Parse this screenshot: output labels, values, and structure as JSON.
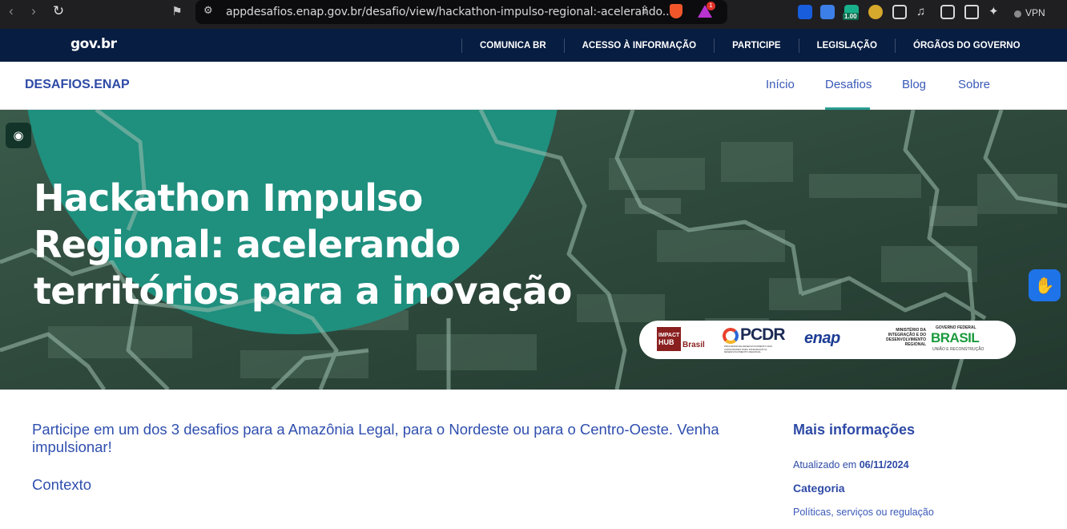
{
  "browser": {
    "url": "appdesafios.enap.gov.br/desafio/view/hackathon-impulso-regional:-acelerando...",
    "vpn_label": "VPN",
    "ext_badge": "1.00",
    "brave_badge": "1"
  },
  "govbar": {
    "logo": "gov.br",
    "links": [
      "COMUNICA BR",
      "ACESSO À INFORMAÇÃO",
      "PARTICIPE",
      "LEGISLAÇÃO",
      "ÓRGÃOS DO GOVERNO"
    ]
  },
  "site": {
    "brand": "DESAFIOS.ENAP",
    "nav": [
      "Início",
      "Desafios",
      "Blog",
      "Sobre"
    ],
    "active_nav": "Desafios"
  },
  "hero": {
    "title": "Hackathon Impulso Regional: acelerando territórios para a inovação",
    "partners": {
      "impact_hub_line1": "IMPACT",
      "impact_hub_line2": "HUB",
      "impact_hub_brasil": "Brasil",
      "pcdr": "PCDR",
      "pcdr_sub": "PROGRAMA DE DESENVOLVIMENTO DAS CAPACIDADES PARA INTEGRAÇÃO E DESENVOLVIMENTO REGIONAL",
      "enap": "enap",
      "ministerio": "MINISTÉRIO DA INTEGRAÇÃO E DO DESENVOLVIMENTO REGIONAL",
      "governo_federal": "GOVERNO FEDERAL",
      "brasil": "BRASIL",
      "uniao": "UNIÃO E RECONSTRUÇÃO"
    }
  },
  "content": {
    "lead": "Participe em um dos 3 desafios para a Amazônia Legal, para o Nordeste ou para o Centro-Oeste. Venha impulsionar!",
    "section_title": "Contexto"
  },
  "aside": {
    "title": "Mais informações",
    "updated_prefix": "Atualizado em",
    "updated_date": "06/11/2024",
    "category_title": "Categoria",
    "category_value": "Políticas, serviços ou regulação"
  },
  "colors": {
    "gov_navy": "#071d41",
    "brand_blue": "#2e4aa6",
    "teal": "#1f8f7e",
    "vlibras_blue": "#1e73e8"
  }
}
